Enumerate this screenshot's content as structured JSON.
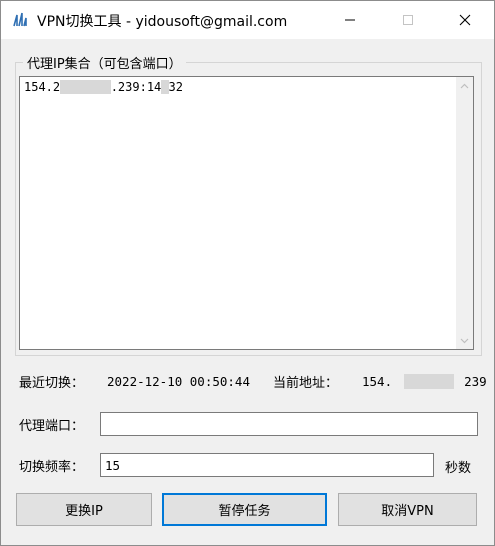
{
  "window": {
    "title": "VPN切换工具 - yidousoft@gmail.com"
  },
  "icons": {
    "app": "app-logo-icon",
    "minimize": "minimize-icon",
    "maximize": "maximize-icon",
    "close": "close-icon"
  },
  "proxy_group": {
    "label": "代理IP集合（可包含端口）",
    "entry_prefix": "154.2",
    "entry_middle": ".239:14",
    "entry_suffix": "32"
  },
  "status": {
    "last_switch_label": "最近切换：",
    "last_switch_value": "2022-12-10 00:50:44",
    "current_address_label": "当前地址：",
    "current_address_prefix": "154.",
    "current_address_suffix": "239"
  },
  "form": {
    "proxy_port_label": "代理端口：",
    "proxy_port_value": "",
    "interval_label": "切换频率：",
    "interval_value": "15",
    "interval_unit": "秒数"
  },
  "buttons": {
    "switch_ip": "更换IP",
    "pause_task": "暂停任务",
    "cancel_vpn": "取消VPN"
  }
}
